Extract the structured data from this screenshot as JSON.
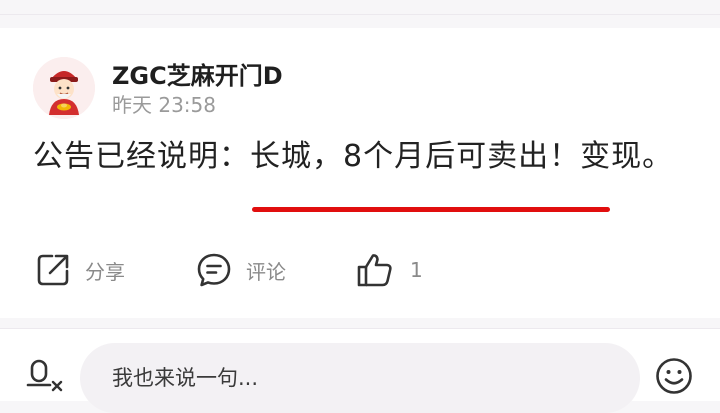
{
  "post": {
    "author": "ZGC芝麻开门D",
    "time": "昨天 23:58",
    "text": "公告已经说明：长城，8个月后可卖出！变现。"
  },
  "actions": {
    "share_label": "分享",
    "comment_label": "评论",
    "like_count": "1"
  },
  "comment_bar": {
    "placeholder": "我也来说一句..."
  },
  "icons": {
    "share": "share-icon",
    "comment": "comment-icon",
    "like": "thumbs-up-icon",
    "voice": "voice-input-icon",
    "emoji": "emoji-icon"
  },
  "colors": {
    "highlight_underline": "#e10e0e",
    "muted_text": "#8a8a8a"
  }
}
